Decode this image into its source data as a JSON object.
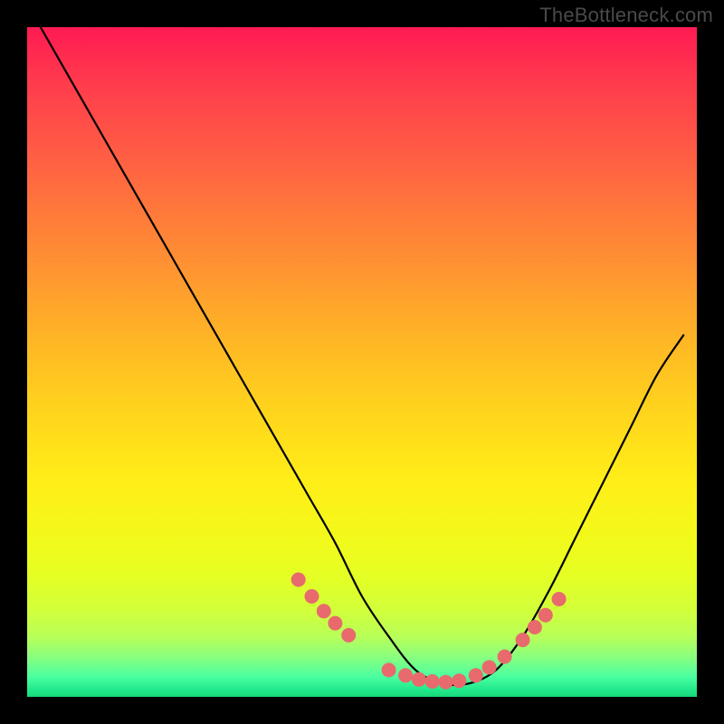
{
  "watermark": "TheBottleneck.com",
  "colors": {
    "frame": "#000000",
    "curve": "#000000",
    "marker_fill": "#e86a6d",
    "gradient_top": "#ff1a52",
    "gradient_mid": "#ffee18",
    "gradient_bottom": "#18d878"
  },
  "chart_data": {
    "type": "line",
    "title": "",
    "xlabel": "",
    "ylabel": "",
    "xlim": [
      0,
      100
    ],
    "ylim": [
      0,
      100
    ],
    "x": [
      2,
      6,
      10,
      14,
      18,
      22,
      26,
      30,
      34,
      38,
      42,
      46,
      50,
      54,
      58,
      62,
      66,
      70,
      74,
      78,
      82,
      86,
      90,
      94,
      98
    ],
    "y": [
      100,
      93,
      86,
      79,
      72,
      65,
      58,
      51,
      44,
      37,
      30,
      23,
      15,
      9,
      4,
      2,
      2,
      4,
      9,
      16,
      24,
      32,
      40,
      48,
      54
    ],
    "marker_points": {
      "x": [
        40.5,
        42.5,
        44.3,
        46.0,
        48.0,
        54.0,
        56.5,
        58.5,
        60.5,
        62.5,
        64.5,
        67.0,
        69.0,
        71.3,
        74.0,
        75.8,
        77.4,
        79.4
      ],
      "y": [
        17.5,
        15.0,
        12.8,
        11.0,
        9.2,
        4.0,
        3.2,
        2.6,
        2.3,
        2.2,
        2.4,
        3.2,
        4.4,
        6.0,
        8.5,
        10.4,
        12.2,
        14.6
      ]
    },
    "note": "V-shaped bottleneck curve over rainbow gradient; y estimated as bottleneck % (0 at minimum)."
  }
}
